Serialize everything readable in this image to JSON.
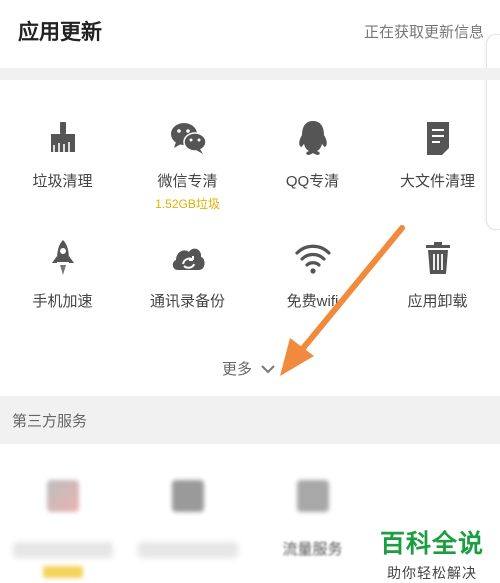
{
  "header": {
    "title": "应用更新",
    "status": "正在获取更新信息"
  },
  "tools": [
    {
      "label": "垃圾清理",
      "icon": "broom-icon"
    },
    {
      "label": "微信专清",
      "icon": "wechat-icon",
      "sub": "1.52GB垃圾"
    },
    {
      "label": "QQ专清",
      "icon": "qq-penguin-icon"
    },
    {
      "label": "大文件清理",
      "icon": "document-icon"
    },
    {
      "label": "手机加速",
      "icon": "rocket-icon"
    },
    {
      "label": "通讯录备份",
      "icon": "cloud-sync-icon"
    },
    {
      "label": "免费wifi",
      "icon": "wifi-icon"
    },
    {
      "label": "应用卸载",
      "icon": "trash-icon"
    }
  ],
  "more": {
    "label": "更多"
  },
  "third_party": {
    "title": "第三方服务",
    "partial_label": "流量服务"
  },
  "watermark": {
    "brand": "百科全说",
    "tagline": "助你轻松解决"
  },
  "colors": {
    "icon": "#555555",
    "accent_yellow": "#e2b000",
    "arrow": "#f08a3c",
    "watermark_green": "#1a9e3f"
  }
}
